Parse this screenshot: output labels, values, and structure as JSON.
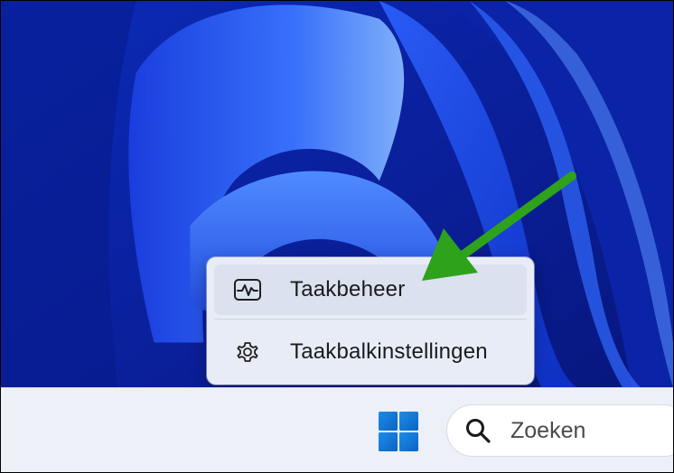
{
  "context_menu": {
    "items": [
      {
        "label": "Taakbeheer",
        "icon": "task-manager-icon"
      },
      {
        "label": "Taakbalkinstellingen",
        "icon": "gear-icon"
      }
    ]
  },
  "taskbar": {
    "start_icon": "windows-logo-icon",
    "search": {
      "placeholder": "Zoeken",
      "icon": "search-icon"
    }
  },
  "colors": {
    "arrow": "#2ea21b",
    "wallpaper_dark": "#0a1f8f",
    "wallpaper_light": "#3f7bff",
    "windows_logo": "#1479d6",
    "menu_bg": "#e8ecf6",
    "taskbar_bg": "#edf0f6"
  }
}
